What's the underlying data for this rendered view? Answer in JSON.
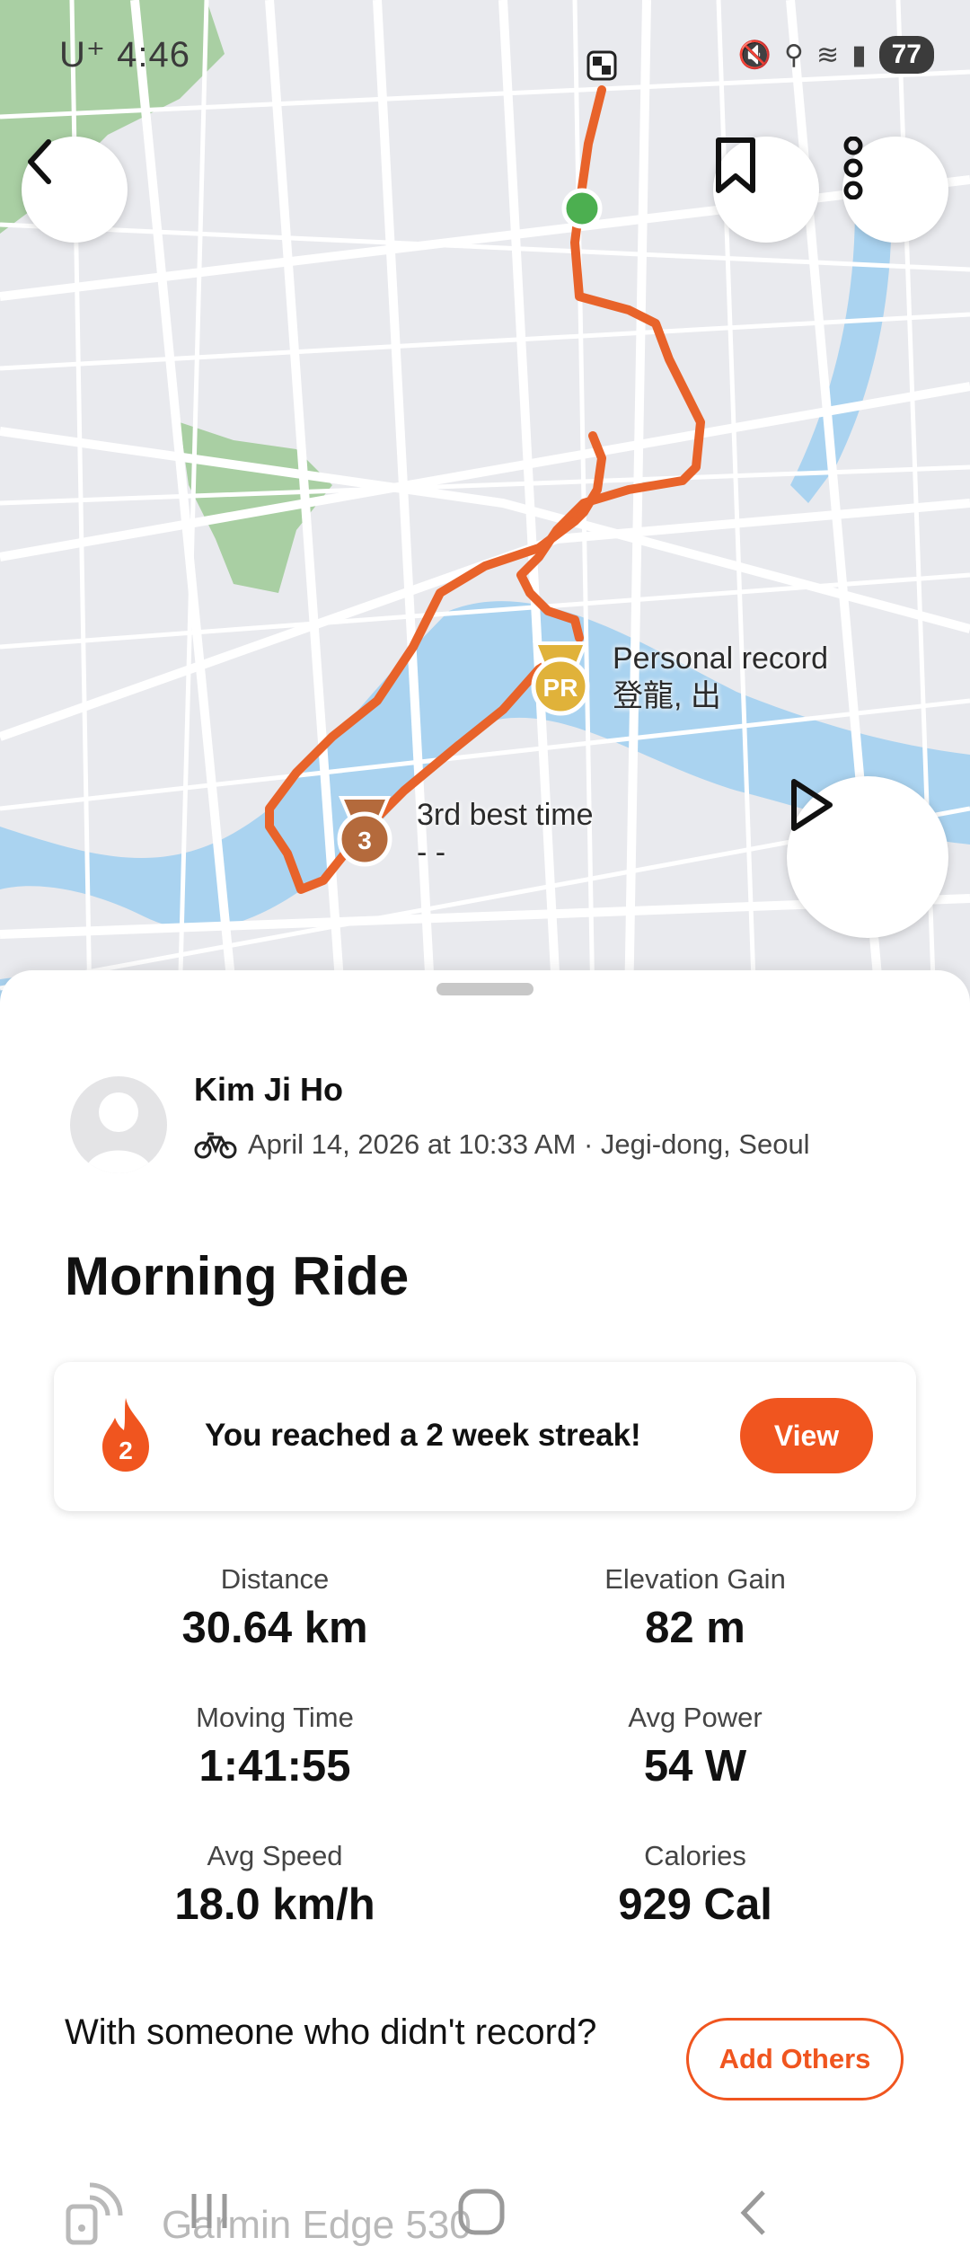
{
  "status_bar": {
    "carrier": "U⁺",
    "time": "4:46",
    "battery": "77"
  },
  "map": {
    "pr_label_line1": "Personal record",
    "pr_label_line2": "登龍, 出",
    "pr_badge": "PR",
    "third_label_line1": "3rd best time",
    "third_label_line2": "- -",
    "third_badge": "3",
    "route_color": "#e8632a",
    "water_color": "#aad3f0",
    "park_color": "#9fc99a"
  },
  "activity": {
    "athlete": "Kim Ji Ho",
    "meta": "April 14, 2026 at 10:33 AM · Jegi-dong, Seoul",
    "title": "Morning Ride"
  },
  "streak": {
    "count": "2",
    "text": "You reached a 2 week streak!",
    "button": "View"
  },
  "stats": [
    {
      "label": "Distance",
      "value": "30.64 km"
    },
    {
      "label": "Elevation Gain",
      "value": "82 m"
    },
    {
      "label": "Moving Time",
      "value": "1:41:55"
    },
    {
      "label": "Avg Power",
      "value": "54 W"
    },
    {
      "label": "Avg Speed",
      "value": "18.0 km/h"
    },
    {
      "label": "Calories",
      "value": "929 Cal"
    }
  ],
  "others": {
    "question": "With someone who didn't record?",
    "button": "Add Others"
  },
  "device": "Garmin Edge 530",
  "colors": {
    "accent": "#f0551f"
  }
}
